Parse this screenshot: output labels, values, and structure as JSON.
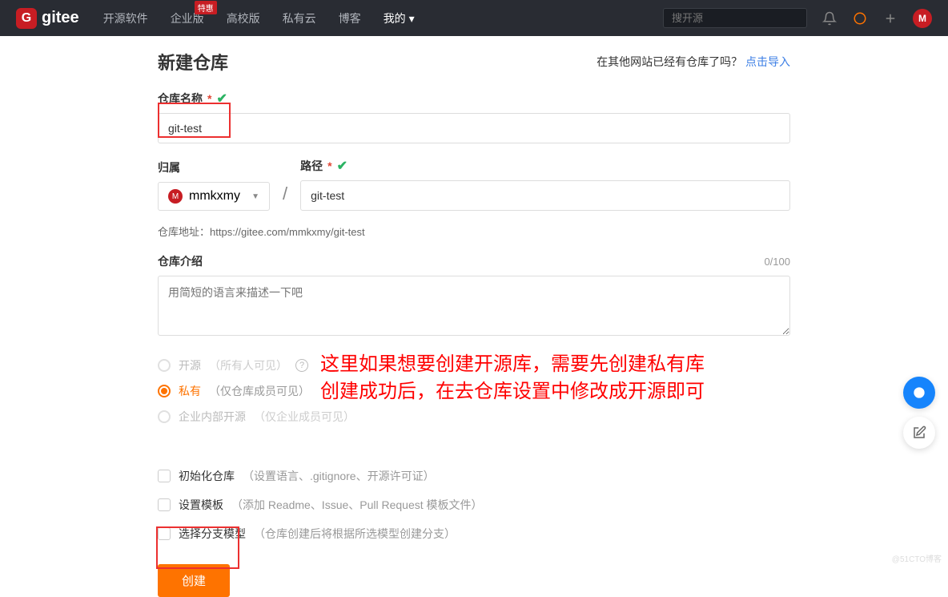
{
  "header": {
    "logo": "gitee",
    "nav": [
      "开源软件",
      "企业版",
      "高校版",
      "私有云",
      "博客",
      "我的"
    ],
    "badge": "特惠",
    "searchPlaceholder": "搜开源",
    "avatarLetter": "M"
  },
  "page": {
    "title": "新建仓库",
    "importQuestion": "在其他网站已经有仓库了吗？",
    "importLink": "点击导入"
  },
  "form": {
    "nameLabel": "仓库名称",
    "nameValue": "git-test",
    "ownerLabel": "归属",
    "ownerValue": "mmkxmy",
    "ownerAvatar": "M",
    "pathLabel": "路径",
    "pathValue": "git-test",
    "urlLabel": "仓库地址：",
    "urlValue": "https://gitee.com/mmkxmy/git-test",
    "introLabel": "仓库介绍",
    "introCounter": "0/100",
    "introPlaceholder": "用简短的语言来描述一下吧"
  },
  "visibility": {
    "open": {
      "label": "开源",
      "hint": "（所有人可见）"
    },
    "private": {
      "label": "私有",
      "hint": "（仅仓库成员可见）"
    },
    "enterprise": {
      "label": "企业内部开源",
      "hint": "（仅企业成员可见）"
    }
  },
  "annotation": {
    "line1": "这里如果想要创建开源库，需要先创建私有库",
    "line2": "创建成功后，在去仓库设置中修改成开源即可"
  },
  "options": {
    "init": {
      "label": "初始化仓库",
      "hint": "（设置语言、.gitignore、开源许可证）"
    },
    "template": {
      "label": "设置模板",
      "hint": "（添加 Readme、Issue、Pull Request 模板文件）"
    },
    "branch": {
      "label": "选择分支模型",
      "hint": "（仓库创建后将根据所选模型创建分支）"
    }
  },
  "submit": "创建",
  "watermark": "@51CTO博客"
}
